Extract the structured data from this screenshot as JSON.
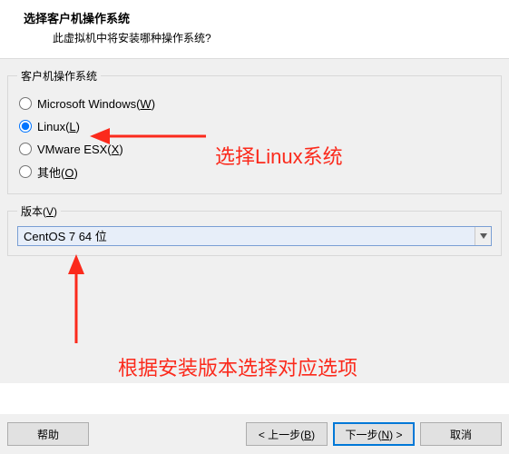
{
  "header": {
    "title": "选择客户机操作系统",
    "subtitle": "此虚拟机中将安装哪种操作系统?"
  },
  "osGroup": {
    "legend": "客户机操作系统",
    "options": [
      {
        "label": "Microsoft Windows(",
        "hotkey": "W",
        "suffix": ")",
        "checked": false
      },
      {
        "label": "Linux(",
        "hotkey": "L",
        "suffix": ")",
        "checked": true
      },
      {
        "label": "VMware ESX(",
        "hotkey": "X",
        "suffix": ")",
        "checked": false
      },
      {
        "label": "其他(",
        "hotkey": "O",
        "suffix": ")",
        "checked": false
      }
    ]
  },
  "versionGroup": {
    "legend_label": "版本(",
    "legend_hotkey": "V",
    "legend_suffix": ")",
    "selected": "CentOS 7 64 位"
  },
  "annotations": {
    "top": "选择Linux系统",
    "bottom": "根据安装版本选择对应选项",
    "arrowColor": "#fb2a1c"
  },
  "footer": {
    "help": "帮助",
    "back_pre": "< 上一步(",
    "back_hot": "B",
    "back_suf": ")",
    "next_pre": "下一步(",
    "next_hot": "N",
    "next_suf": ") >",
    "cancel": "取消"
  }
}
